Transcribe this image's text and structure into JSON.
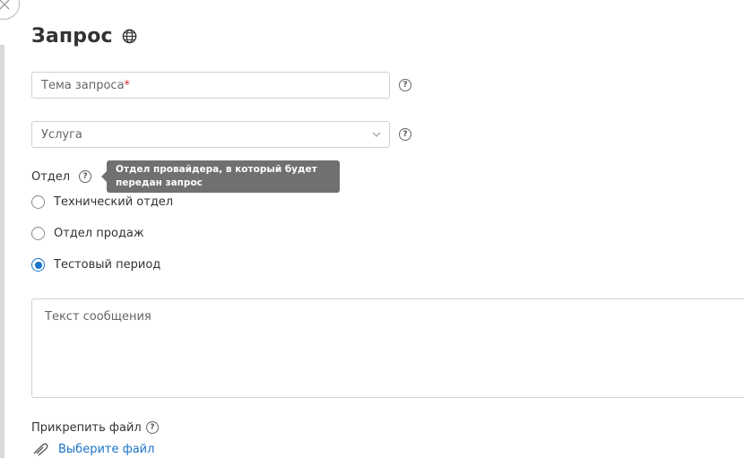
{
  "window": {
    "close_icon": "close-icon"
  },
  "header": {
    "title": "Запрос",
    "icon": "globe-icon"
  },
  "subject": {
    "placeholder": "Тема запроса",
    "required_mark": "*"
  },
  "service": {
    "selected": "Услуга"
  },
  "department": {
    "label": "Отдел",
    "tooltip": "Отдел провайдера, в который будет передан запрос",
    "options": [
      {
        "label": "Технический отдел",
        "checked": false
      },
      {
        "label": "Отдел продаж",
        "checked": false
      },
      {
        "label": "Тестовый период",
        "checked": true
      }
    ]
  },
  "message": {
    "placeholder": "Текст сообщения"
  },
  "attachment": {
    "label": "Прикрепить файл",
    "link": "Выберите файл"
  },
  "help_glyph": "?",
  "colors": {
    "accent": "#1a73c9",
    "required": "#d12b2b",
    "tooltip_bg": "#707070"
  }
}
